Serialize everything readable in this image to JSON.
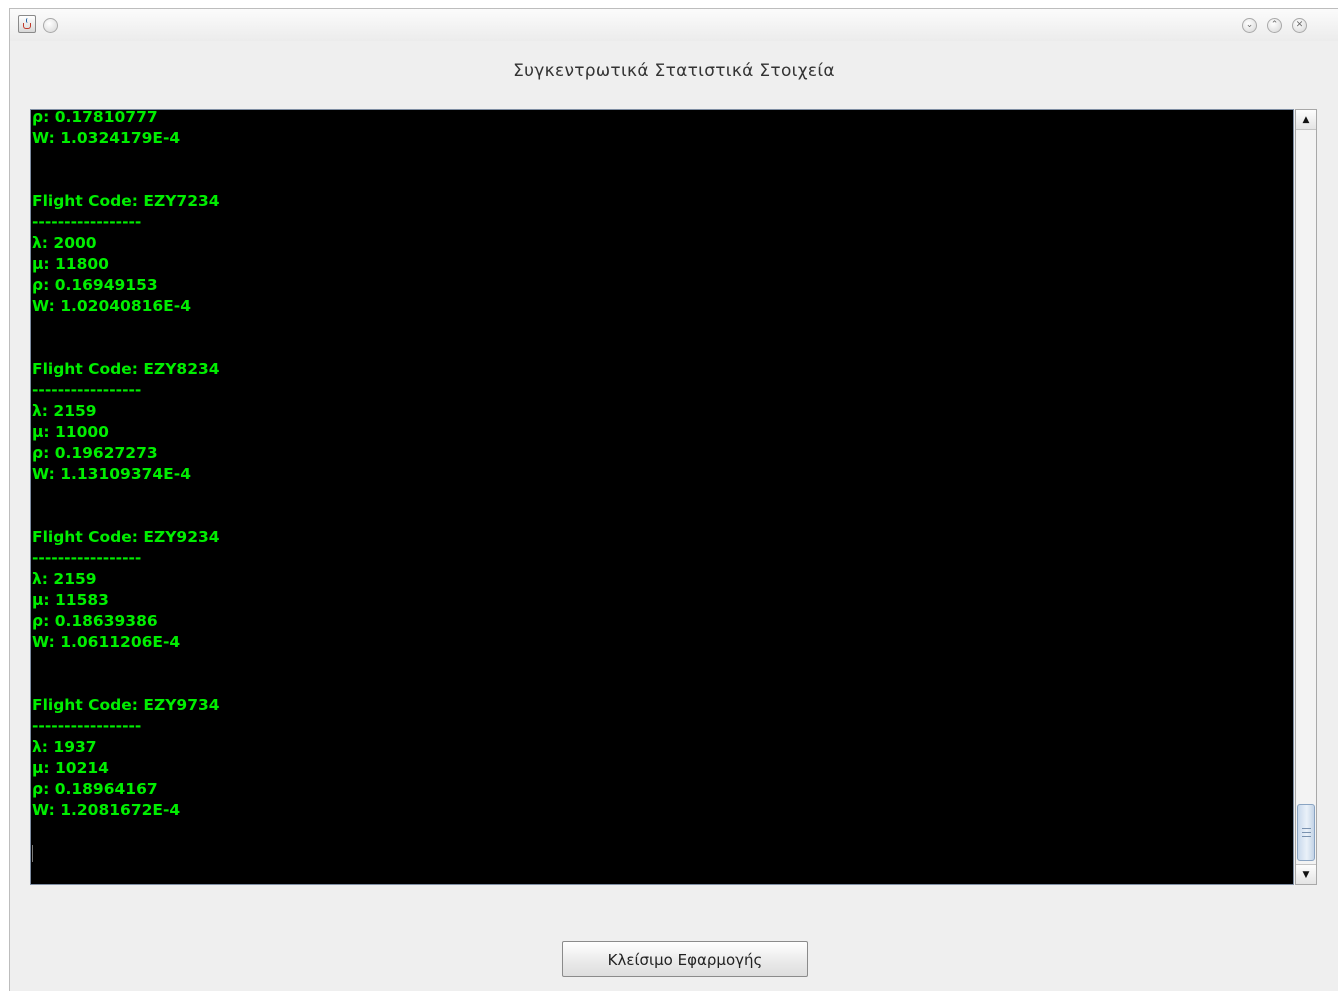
{
  "window": {
    "dialog_title": "Συγκεντρωτικά Στατιστικά Στοιχεία"
  },
  "titlebar": {
    "icons": [
      "java-app-icon",
      "menu-icon",
      "minimize-icon",
      "maximize-icon",
      "close-icon"
    ]
  },
  "console": {
    "text": "ρ: 0.17810777\nW: 1.0324179E-4\n\n\nFlight Code: EZY7234\n-----------------\nλ: 2000\nμ: 11800\nρ: 0.16949153\nW: 1.02040816E-4\n\n\nFlight Code: EZY8234\n-----------------\nλ: 2159\nμ: 11000\nρ: 0.19627273\nW: 1.13109374E-4\n\n\nFlight Code: EZY9234\n-----------------\nλ: 2159\nμ: 11583\nρ: 0.18639386\nW: 1.0611206E-4\n\n\nFlight Code: EZY9734\n-----------------\nλ: 1937\nμ: 10214\nρ: 0.18964167\nW: 1.2081672E-4"
  },
  "scrollbar": {
    "position": 1.0
  },
  "buttons": {
    "close_app_label": "Κλείσιμο Εφαρμογής"
  },
  "colors": {
    "console_background": "#000000",
    "console_text": "#00ee00",
    "window_background": "#efefef"
  }
}
